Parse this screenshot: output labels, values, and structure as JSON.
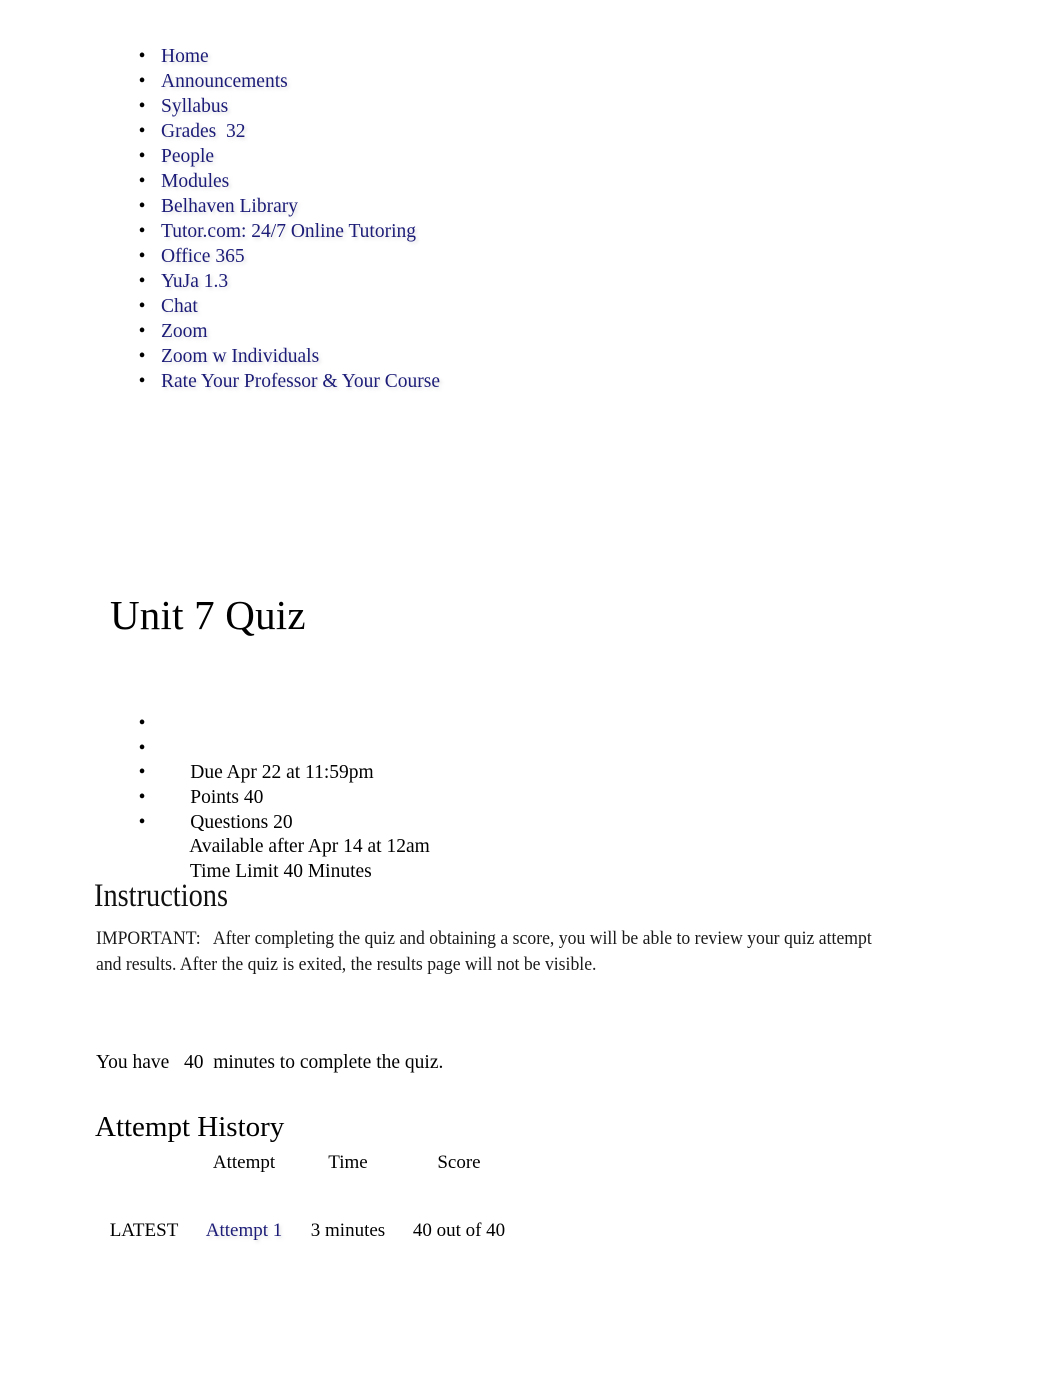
{
  "course_nav": {
    "bullet": "•",
    "items": [
      {
        "label": "Home",
        "name": "nav-home"
      },
      {
        "label": "Announcements",
        "name": "nav-announcements"
      },
      {
        "label": "Syllabus",
        "name": "nav-syllabus"
      },
      {
        "label": "Grades  32",
        "name": "nav-grades"
      },
      {
        "label": "People",
        "name": "nav-people"
      },
      {
        "label": "Modules",
        "name": "nav-modules"
      },
      {
        "label": "Belhaven Library",
        "name": "nav-belhaven-library"
      },
      {
        "label": "Tutor.com: 24/7 Online Tutoring",
        "name": "nav-tutor-com"
      },
      {
        "label": "Office 365",
        "name": "nav-office-365"
      },
      {
        "label": "YuJa 1.3",
        "name": "nav-yuja"
      },
      {
        "label": "Chat",
        "name": "nav-chat"
      },
      {
        "label": "Zoom",
        "name": "nav-zoom"
      },
      {
        "label": "Zoom w Individuals",
        "name": "nav-zoom-w-individuals"
      },
      {
        "label": "Rate Your Professor & Your Course",
        "name": "nav-rate-your-professor"
      }
    ]
  },
  "quiz": {
    "title": "Unit 7 Quiz",
    "bullet": "•",
    "meta": [
      "Due Apr 22 at 11:59pm",
      "Points 40",
      "Questions 20",
      "Available after Apr 14 at 12am",
      "Time Limit 40 Minutes"
    ]
  },
  "instructions": {
    "heading": "Instructions",
    "body": "IMPORTANT:   After completing the quiz and obtaining a score, you will be able to review your quiz attempt and results. After the quiz is exited, the results page will not be visible."
  },
  "time_note": "You have   40  minutes to complete the quiz.",
  "attempt_history": {
    "heading": "Attempt History",
    "columns": [
      "",
      "Attempt",
      "Time",
      "Score"
    ],
    "rows": [
      {
        "kept": "LATEST",
        "attempt": "Attempt 1",
        "time": "3 minutes",
        "score": "40 out of 40"
      }
    ]
  },
  "colors": {
    "link": "#1c1c78",
    "text": "#000000",
    "background": "#ffffff"
  }
}
